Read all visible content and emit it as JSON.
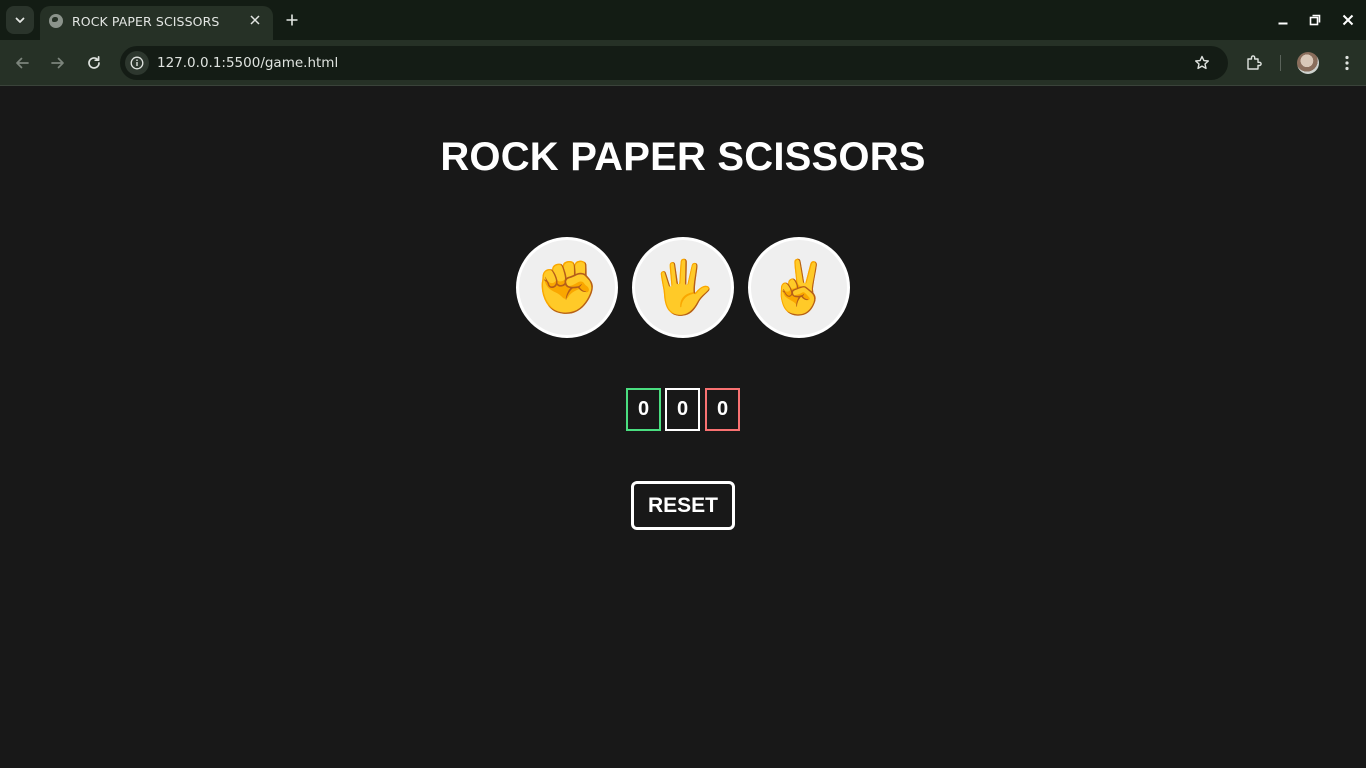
{
  "browser": {
    "tab_title": "ROCK PAPER SCISSORS",
    "url": "127.0.0.1:5500/game.html"
  },
  "game": {
    "title": "ROCK PAPER SCISSORS",
    "choices": [
      {
        "name": "rock",
        "glyph": "✊"
      },
      {
        "name": "paper",
        "glyph": "🖐"
      },
      {
        "name": "scissors",
        "glyph": "✌"
      }
    ],
    "scores": {
      "wins": "0",
      "draws": "0",
      "losses": "0"
    },
    "reset_label": "RESET"
  },
  "colors": {
    "background": "#181818",
    "win_border": "#4ade80",
    "draw_border": "#ffffff",
    "loss_border": "#f87171",
    "emoji_yellow": "#fbbf24"
  }
}
